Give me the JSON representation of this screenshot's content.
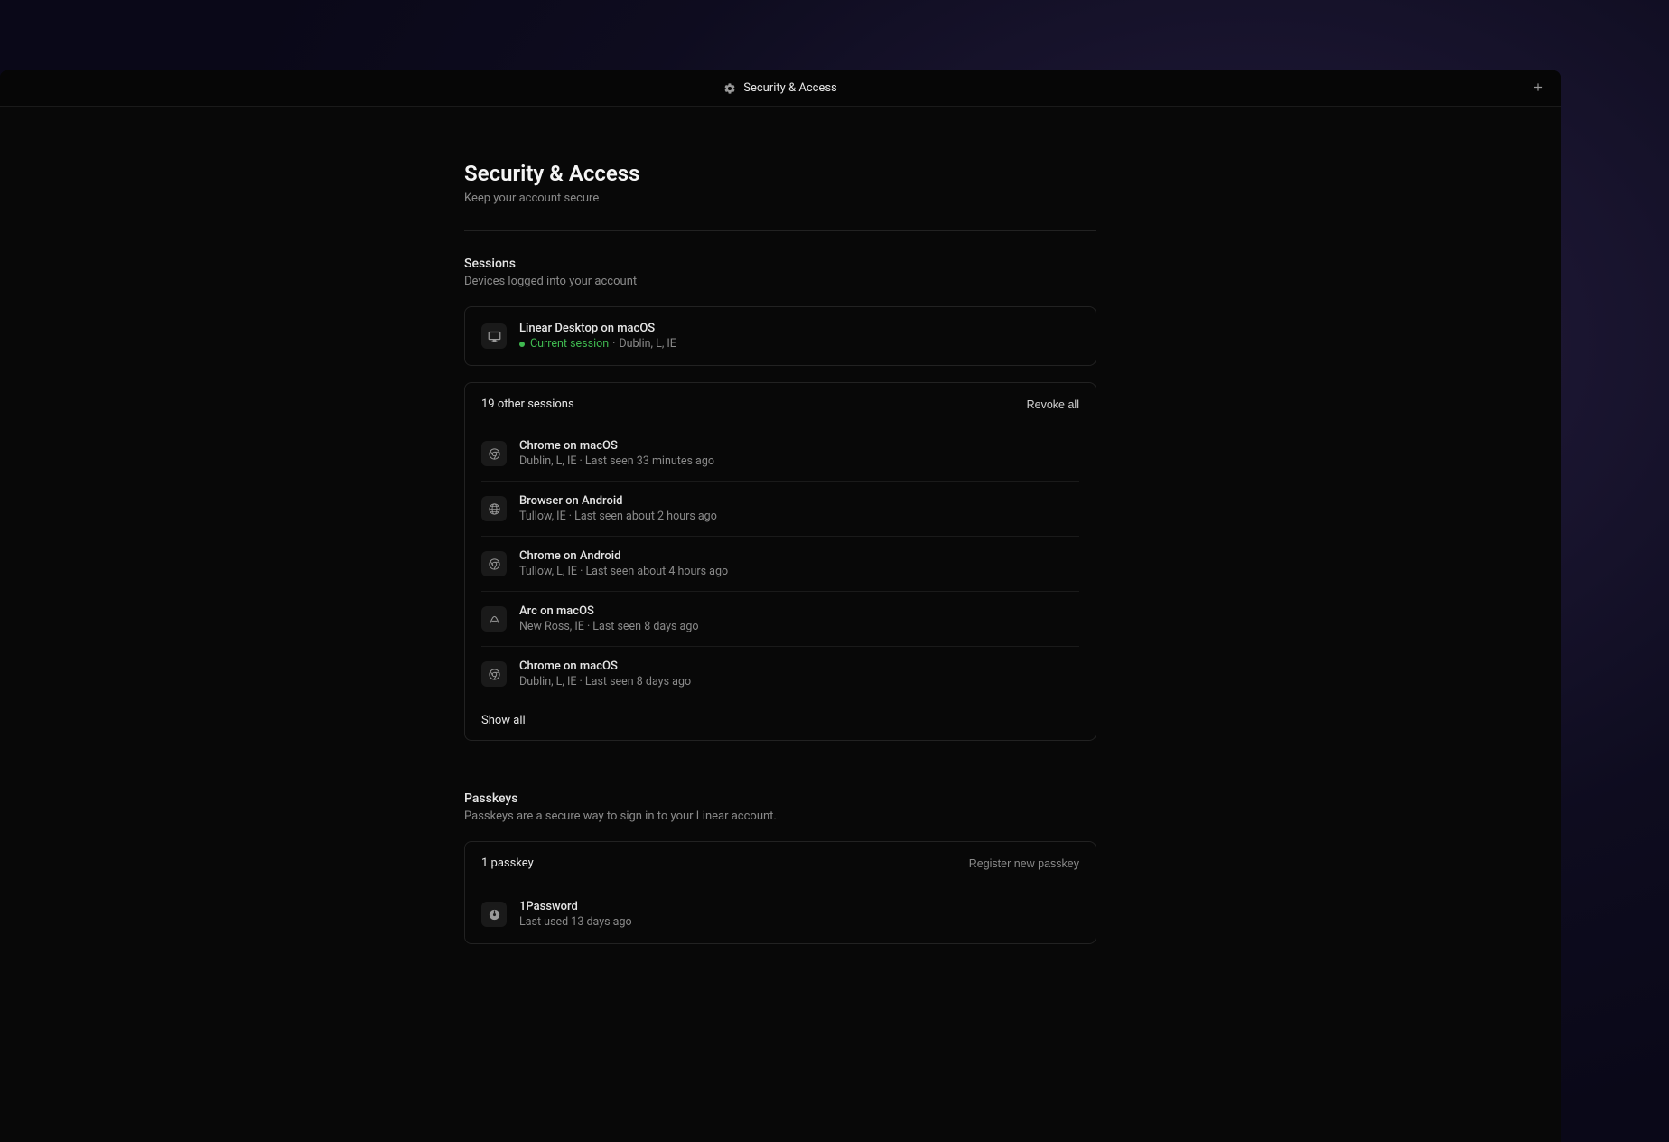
{
  "titlebar": {
    "title": "Security & Access"
  },
  "page": {
    "title": "Security & Access",
    "subtitle": "Keep your account secure"
  },
  "sessions": {
    "title": "Sessions",
    "subtitle": "Devices logged into your account",
    "current": {
      "name": "Linear Desktop on macOS",
      "status": "Current session",
      "location": "Dublin, L, IE"
    },
    "other_count_label": "19 other sessions",
    "revoke_all_label": "Revoke all",
    "others": [
      {
        "name": "Chrome on macOS",
        "meta": "Dublin, L, IE · Last seen 33 minutes ago",
        "icon": "chrome"
      },
      {
        "name": "Browser on Android",
        "meta": "Tullow, IE · Last seen about 2 hours ago",
        "icon": "globe"
      },
      {
        "name": "Chrome on Android",
        "meta": "Tullow, L, IE · Last seen about 4 hours ago",
        "icon": "chrome"
      },
      {
        "name": "Arc on macOS",
        "meta": "New Ross, IE · Last seen 8 days ago",
        "icon": "arc"
      },
      {
        "name": "Chrome on macOS",
        "meta": "Dublin, L, IE · Last seen 8 days ago",
        "icon": "chrome"
      }
    ],
    "show_all_label": "Show all"
  },
  "passkeys": {
    "title": "Passkeys",
    "subtitle": "Passkeys are a secure way to sign in to your Linear account.",
    "count_label": "1 passkey",
    "register_label": "Register new passkey",
    "items": [
      {
        "name": "1Password",
        "meta": "Last used 13 days ago"
      }
    ]
  }
}
